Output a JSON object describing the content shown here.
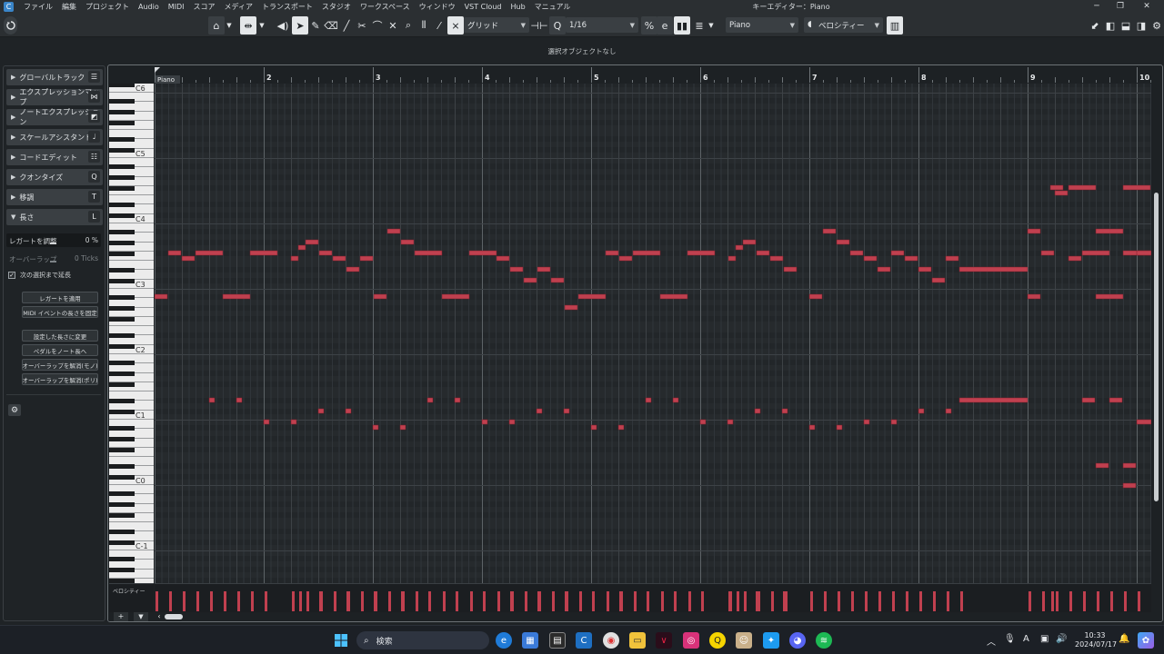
{
  "menubar": {
    "items": [
      "ファイル",
      "編集",
      "プロジェクト",
      "Audio",
      "MIDI",
      "スコア",
      "メディア",
      "トランスポート",
      "スタジオ",
      "ワークスペース",
      "ウィンドウ",
      "VST Cloud",
      "Hub",
      "マニュアル"
    ],
    "title": "キーエディター：Piano",
    "window_controls": [
      "─",
      "❐",
      "✕"
    ]
  },
  "toolbar": {
    "snap_type": "グリッド",
    "quantize": "1/16",
    "track": "Piano",
    "lane": "ベロシティー",
    "quantize_icon": "Q"
  },
  "infoline": {
    "text": "選択オブジェクトなし"
  },
  "inspector": {
    "sections": [
      {
        "label": "グローバルトラック",
        "icon": "☰"
      },
      {
        "label": "エクスプレッションマップ",
        "icon": "⋈"
      },
      {
        "label": "ノートエクスプレッション",
        "icon": "◩"
      },
      {
        "label": "スケールアシスタント",
        "icon": "♩"
      },
      {
        "label": "コードエディット",
        "icon": "☷"
      },
      {
        "label": "クオンタイズ",
        "icon": "Q"
      },
      {
        "label": "移調",
        "icon": "T"
      }
    ],
    "length_section": {
      "label": "長さ",
      "icon": "L"
    },
    "legato": {
      "label": "レガートを調整",
      "value": "0 %",
      "percent": 0
    },
    "overlap": {
      "label": "オーバーラップ",
      "value": "0 Ticks"
    },
    "extend_check": {
      "label": "次の選択まで延長",
      "checked": true
    },
    "buttons": [
      "レガートを適用",
      "MIDI イベントの長さを固定"
    ],
    "buttons2": [
      "設定した長さに変更",
      "ペダルをノート長へ",
      "オーバーラップを解消(モノ)",
      "オーバーラップを解消(ポリ)"
    ]
  },
  "editor": {
    "part_name": "Piano",
    "ruler_bars": [
      "2",
      "3",
      "4",
      "5",
      "6",
      "7",
      "8",
      "9",
      "10"
    ],
    "octave_labels": [
      "C6",
      "C5",
      "C4",
      "C3",
      "C2",
      "C1",
      "C0",
      "C-1"
    ],
    "lane_label": "ベロシティー",
    "note_color": "#c0404f"
  },
  "taskbar": {
    "search": "検索",
    "time": "10:33",
    "date": "2024/07/17",
    "ime": "A"
  }
}
